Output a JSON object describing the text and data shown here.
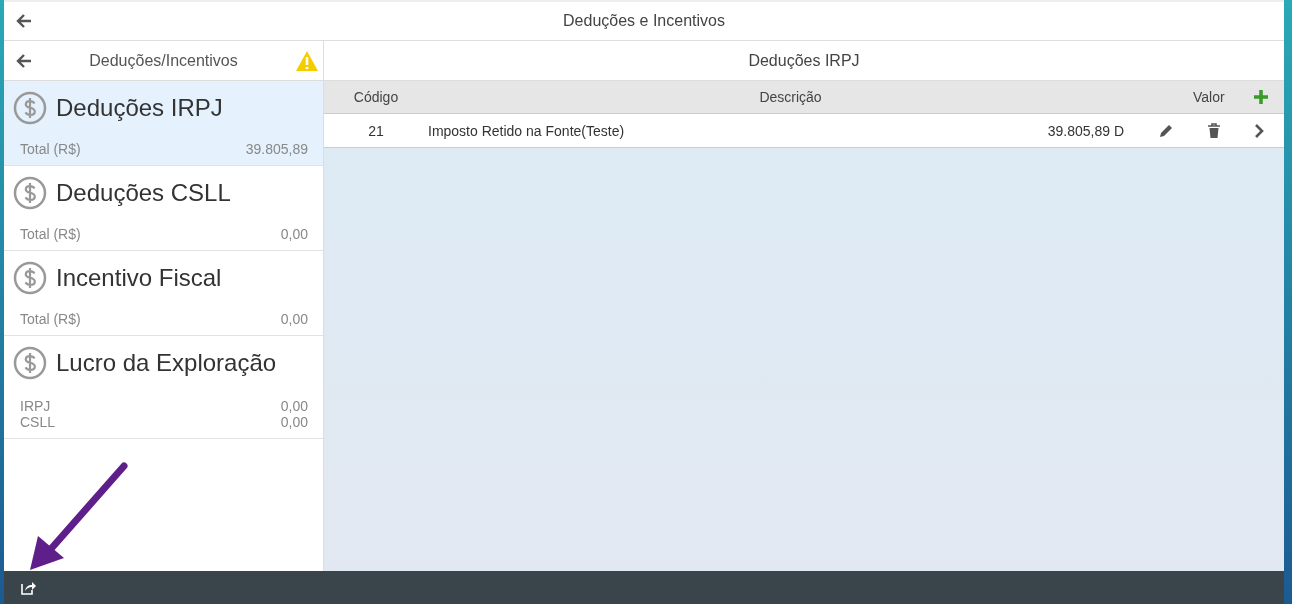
{
  "header": {
    "title": "Deduções e Incentivos"
  },
  "sidebar": {
    "title": "Deduções/Incentivos",
    "warning": true,
    "items": [
      {
        "title": "Deduções IRPJ",
        "selected": true,
        "lines": [
          {
            "label": "Total (R$)",
            "value": "39.805,89"
          }
        ]
      },
      {
        "title": "Deduções CSLL",
        "selected": false,
        "lines": [
          {
            "label": "Total (R$)",
            "value": "0,00"
          }
        ]
      },
      {
        "title": "Incentivo Fiscal",
        "selected": false,
        "lines": [
          {
            "label": "Total (R$)",
            "value": "0,00"
          }
        ]
      },
      {
        "title": "Lucro da Exploração",
        "selected": false,
        "lines": [
          {
            "label": "IRPJ",
            "value": "0,00"
          },
          {
            "label": "CSLL",
            "value": "0,00"
          }
        ]
      }
    ]
  },
  "detail": {
    "title": "Deduções IRPJ",
    "table": {
      "columns": [
        "Código",
        "Descrição",
        "Valor"
      ],
      "rows": [
        {
          "code": "21",
          "description": "Imposto Retido na Fonte(Teste)",
          "value": "39.805,89 D"
        }
      ]
    }
  }
}
